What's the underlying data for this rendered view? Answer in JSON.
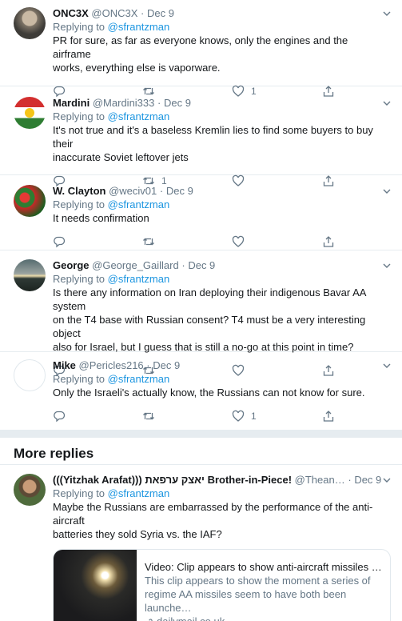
{
  "tweets": [
    {
      "name": "ONC3X",
      "handle": "@ONC3X",
      "date": "Dec 9",
      "replying_label": "Replying to",
      "replying_to": "@sfrantzman",
      "lines": [
        "PR for sure, as far as everyone knows, only the engines and the airframe",
        "works, everything else is vaporware."
      ],
      "retweets": "",
      "likes": "1"
    },
    {
      "name": "Mardini",
      "handle": "@Mardini333",
      "date": "Dec 9",
      "replying_label": "Replying to",
      "replying_to": "@sfrantzman",
      "lines": [
        "It's not true and it's a baseless Kremlin lies to find some buyers to buy their",
        "inaccurate Soviet leftover jets"
      ],
      "retweets": "1",
      "likes": ""
    },
    {
      "name": "W. Clayton",
      "handle": "@weciv01",
      "date": "Dec 9",
      "replying_label": "Replying to",
      "replying_to": "@sfrantzman",
      "lines": [
        "It needs confirmation"
      ],
      "retweets": "",
      "likes": ""
    },
    {
      "name": "George",
      "handle": "@George_Gaillard",
      "date": "Dec 9",
      "replying_label": "Replying to",
      "replying_to": "@sfrantzman",
      "lines": [
        "Is there any information on Iran deploying their indigenous Bavar AA system",
        "on the T4 base with Russian consent? T4 must be a very interesting object",
        "also for Israel, but I guess that is still a no-go at this point in time?"
      ],
      "retweets": "",
      "likes": ""
    },
    {
      "name": "Mike",
      "handle": "@Pericles216",
      "date": "Dec 9",
      "replying_label": "Replying to",
      "replying_to": "@sfrantzman",
      "lines": [
        "Only the Israeli's actually know, the Russians can not know for sure."
      ],
      "retweets": "",
      "likes": "1"
    }
  ],
  "more_replies": {
    "heading": "More replies",
    "tweet": {
      "name": "(((Yitzhak Arafat))) יאצק ערפאת Brother-in-Piece!",
      "handle": "@Thean…",
      "date": "Dec 9",
      "replying_label": "Replying to",
      "replying_to": "@sfrantzman",
      "lines": [
        "Maybe the Russians are embarrassed by the performance of the anti-aircraft",
        "batteries they sold Syria vs. the IAF?"
      ],
      "card": {
        "title": "Video: Clip appears to show anti-aircraft missiles faili…",
        "desc_lines": [
          "This clip appears to show the moment a series of",
          "regime AA missiles seem to have both been launche…"
        ],
        "domain": "dailymail.co.uk"
      }
    }
  },
  "colors": {
    "accent": "#1b95e0",
    "muted": "#657786",
    "border": "#e6ecf0"
  }
}
